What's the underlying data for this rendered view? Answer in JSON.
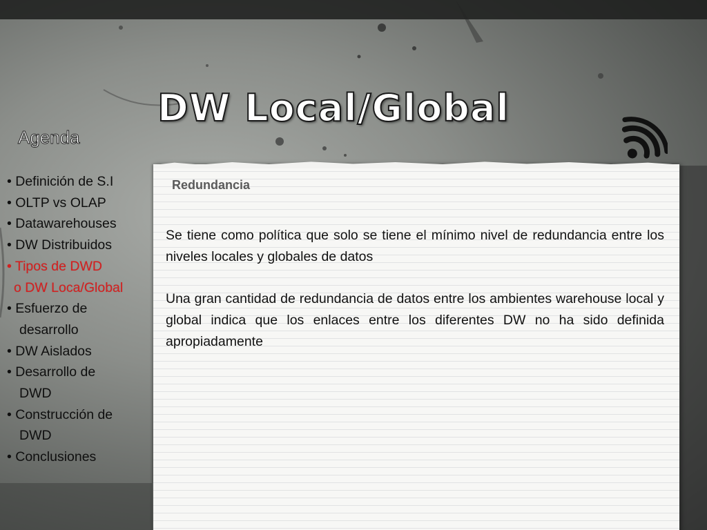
{
  "slide": {
    "title": "DW Local/Global"
  },
  "agenda": {
    "heading": "Agenda",
    "items": [
      {
        "text": "• Definición de S.I"
      },
      {
        "text": "• OLTP vs OLAP"
      },
      {
        "text": "• Datawarehouses"
      },
      {
        "text": "• DW Distribuidos"
      },
      {
        "text": "• Tipos de DWD"
      },
      {
        "text": "o  DW Loca/Global"
      },
      {
        "text": "• Esfuerzo de",
        "cont": "desarrollo"
      },
      {
        "text": "• DW Aislados"
      },
      {
        "text": "• Desarrollo de",
        "cont": "DWD"
      },
      {
        "text": "• Construcción de",
        "cont": "DWD"
      },
      {
        "text": "• Conclusiones"
      }
    ],
    "active_color": "#d42020"
  },
  "content": {
    "heading": "Redundancia",
    "paragraphs": [
      "Se tiene como política que solo se tiene el mínimo nivel de redundancia entre los niveles locales y globales de datos",
      "Una gran cantidad de redundancia de datos entre los ambientes warehouse local y global  indica que los enlaces entre los diferentes DW no ha sido definida apropiadamente"
    ]
  },
  "icons": {
    "rss": "rss-icon"
  }
}
